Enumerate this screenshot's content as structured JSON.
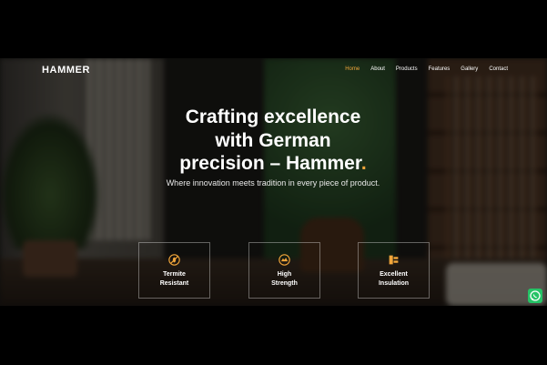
{
  "brand": {
    "logo_text": "HAMMER"
  },
  "nav": {
    "items": [
      {
        "label": "Home",
        "active": true
      },
      {
        "label": "About",
        "active": false
      },
      {
        "label": "Products",
        "active": false
      },
      {
        "label": "Features",
        "active": false
      },
      {
        "label": "Gallery",
        "active": false
      },
      {
        "label": "Contact",
        "active": false
      }
    ],
    "active_color": "#f0a53a"
  },
  "hero": {
    "title_line1": "Crafting excellence",
    "title_line2": "with German",
    "title_line3": "precision – Hammer",
    "title_dot": ".",
    "subtitle": "Where innovation meets tradition in every piece of product."
  },
  "features": [
    {
      "line1": "Termite",
      "line2": "Resistant",
      "icon": "no-termite-icon"
    },
    {
      "line1": "High",
      "line2": "Strength",
      "icon": "strength-icon"
    },
    {
      "line1": "Excellent",
      "line2": "Insulation",
      "icon": "insulation-icon"
    }
  ],
  "widget": {
    "icon": "whatsapp-icon",
    "color": "#25c366"
  },
  "colors": {
    "accent": "#f0a53a",
    "background": "#000000"
  }
}
